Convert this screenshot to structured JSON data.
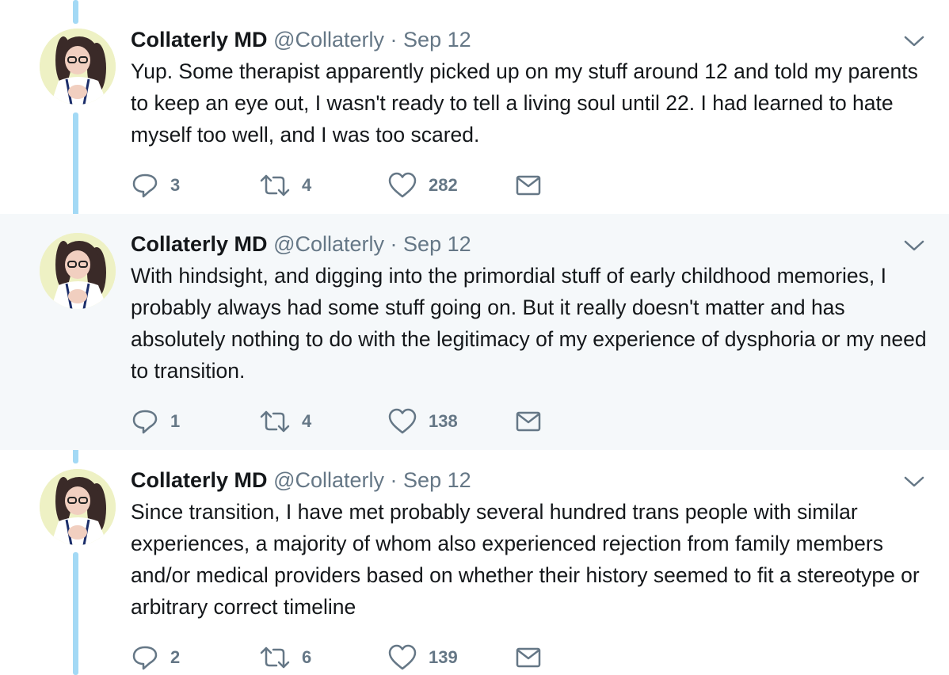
{
  "tweets": [
    {
      "name": "Collaterly MD",
      "handle": "@Collaterly",
      "separator": "·",
      "date": "Sep 12",
      "text": "Yup. Some therapist apparently picked up on my stuff around 12 and told my parents to keep an eye out, I wasn't ready to tell a living soul until 22. I had learned to hate myself too well, and I was too scared.",
      "replies": "3",
      "retweets": "4",
      "likes": "282"
    },
    {
      "name": "Collaterly MD",
      "handle": "@Collaterly",
      "separator": "·",
      "date": "Sep 12",
      "text": "With hindsight, and digging into the primordial stuff of early childhood memories, I probably always had some stuff going on. But it really doesn't matter and has absolutely nothing to do with the legitimacy of my experience of dysphoria or my need to transition.",
      "replies": "1",
      "retweets": "4",
      "likes": "138"
    },
    {
      "name": "Collaterly MD",
      "handle": "@Collaterly",
      "separator": "·",
      "date": "Sep 12",
      "text": "Since transition, I have met probably several hundred trans people with similar experiences, a majority of whom also experienced rejection from family members and/or medical providers based on whether their history seemed to fit a stereotype or arbitrary correct timeline",
      "replies": "2",
      "retweets": "6",
      "likes": "139"
    }
  ],
  "colors": {
    "thread_line": "#a3d9f5",
    "highlight_background": "#f5f8fa",
    "secondary_text": "#657786",
    "primary_text": "#14171a"
  },
  "icons": [
    "reply-icon",
    "retweet-icon",
    "like-icon",
    "direct-message-icon",
    "chevron-down-icon"
  ]
}
